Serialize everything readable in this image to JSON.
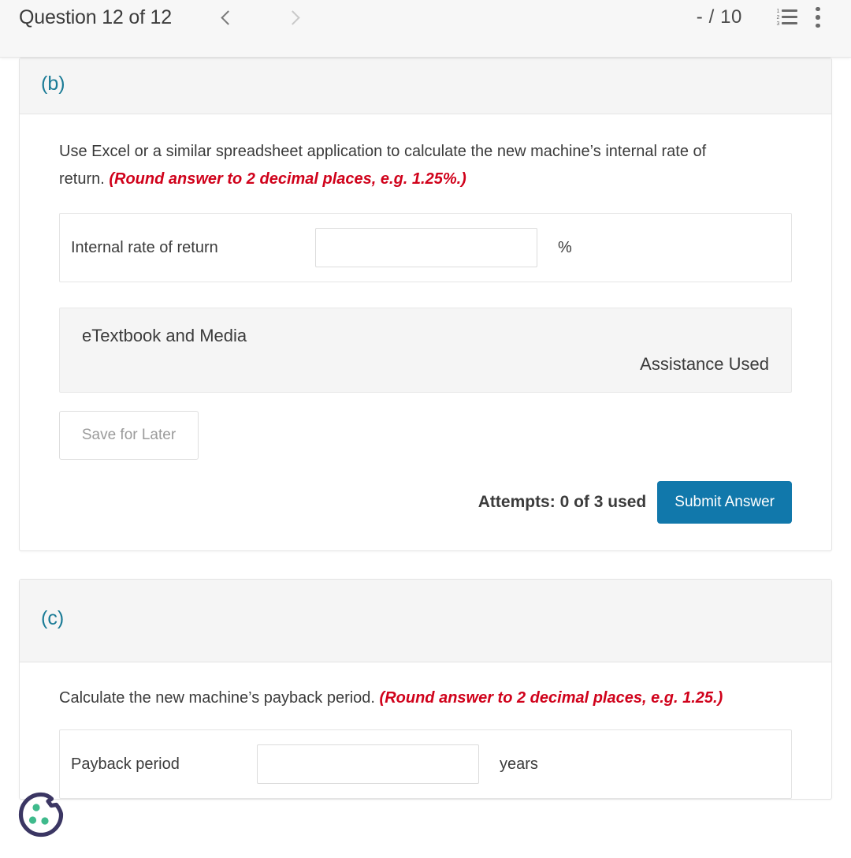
{
  "header": {
    "question_title": "Question 12 of 12",
    "prev_label": "Previous question",
    "next_label": "Next question",
    "score": "- / 10",
    "list_icon_name": "numbered-list-icon",
    "menu_icon_name": "more-options-icon",
    "list_numbers": [
      "1",
      "2",
      "3"
    ]
  },
  "parts": [
    {
      "label": "(b)",
      "prompt_main": "Use Excel or a similar spreadsheet application to calculate the new machine’s internal rate of return. ",
      "prompt_hint": "(Round answer to 2 decimal places, e.g. 1.25%.)",
      "answer_label": "Internal rate of return",
      "answer_value": "",
      "answer_placeholder": "",
      "answer_unit": "%",
      "etextbook_title": "eTextbook and Media",
      "assistance_text": "Assistance Used",
      "save_label": "Save for Later",
      "attempts_text": "Attempts: 0 of 3 used",
      "submit_label": "Submit Answer"
    },
    {
      "label": "(c)",
      "prompt_main": "Calculate the new machine’s payback period. ",
      "prompt_hint": "(Round answer to 2 decimal places, e.g. 1.25.)",
      "answer_label": "Payback period",
      "answer_value": "",
      "answer_placeholder": "",
      "answer_unit": "years"
    }
  ],
  "cookie_widget": {
    "name": "cookie-consent-icon",
    "outline_color": "#3b3663",
    "dot_color": "#3fba8c"
  },
  "colors": {
    "part_label": "#1a7b96",
    "hint_red": "#d0021b",
    "submit_blue": "#1178ab",
    "header_bg": "#f7f7f7",
    "card_header_bg": "#f5f5f5"
  }
}
